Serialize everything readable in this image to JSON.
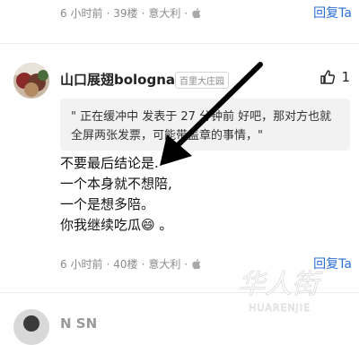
{
  "top_meta": {
    "time": "6 小时前",
    "floor": "39楼",
    "region": "意大利",
    "reply": "回复Ta"
  },
  "comment": {
    "username": "山口展翅bologna",
    "location": "百里大庄园",
    "likes": "1",
    "quote": "\" 正在缓冲中 发表于 27 分钟前 好吧，那对方也就全屏两张发票，可能带盖章的事情，\"",
    "body": [
      "不要最后结论是.",
      "一个本身就不想陪,",
      "一个是想多陪。",
      "你我继续吃瓜😄 。"
    ],
    "time": "6 小时前",
    "floor": "40楼",
    "region": "意大利",
    "reply": "回复Ta"
  },
  "next_user": {
    "username": "N   SN"
  },
  "watermark": {
    "text_cn": "华人街",
    "text_en": "HUARENJIE"
  },
  "colors": {
    "accent": "#2d6fd6",
    "meta": "#8a8a8a",
    "quote_bg": "#f2f2f2"
  }
}
